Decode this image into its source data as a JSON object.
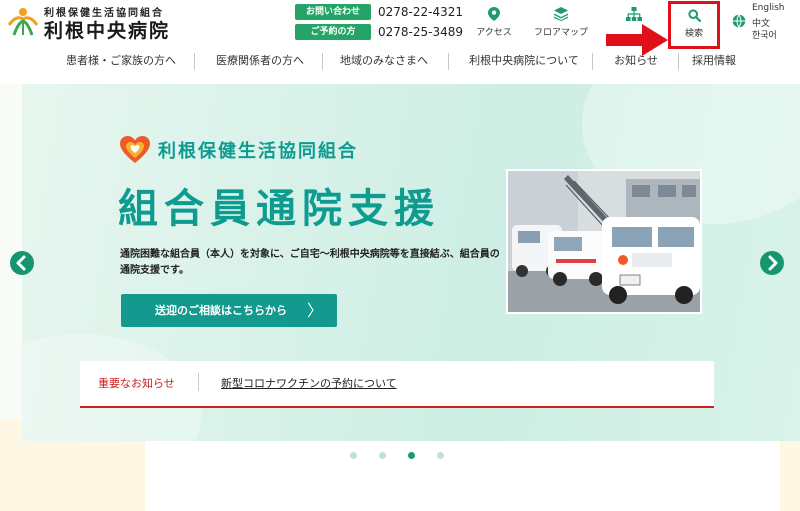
{
  "logo": {
    "subtitle": "利根保健生活協同組合",
    "name": "利根中央病院"
  },
  "contact": [
    {
      "label": "お問い合わせ",
      "number": "0278-22-4321"
    },
    {
      "label": "ご予約の方",
      "number": "0278-25-3489"
    }
  ],
  "header_nav": {
    "access": "アクセス",
    "floor_map": "フロアマップ",
    "search": "検索"
  },
  "languages": [
    "English",
    "中文",
    "한국어"
  ],
  "main_nav": [
    "患者様・ご家族の方へ",
    "医療関係者の方へ",
    "地域のみなさまへ",
    "利根中央病院について",
    "お知らせ",
    "採用情報"
  ],
  "hero": {
    "org_name": "利根保健生活協同組合",
    "title": "組合員通院支援",
    "description": "通院困難な組合員（本人）を対象に、ご自宅〜利根中央病院等を直接結ぶ、組合員の通院支援です。",
    "button_label": "送迎のご相談はこちらから",
    "button_chevron": "〉"
  },
  "notice": {
    "label": "重要なお知らせ",
    "link_text": "新型コロナワクチンの予約について"
  },
  "carousel": {
    "slide_count": 4,
    "active_index": 2
  },
  "colors": {
    "brand_green": "#24a567",
    "teal": "#0e9b90",
    "alert_red": "#cc1f1f",
    "highlight_red": "#e0101a"
  }
}
